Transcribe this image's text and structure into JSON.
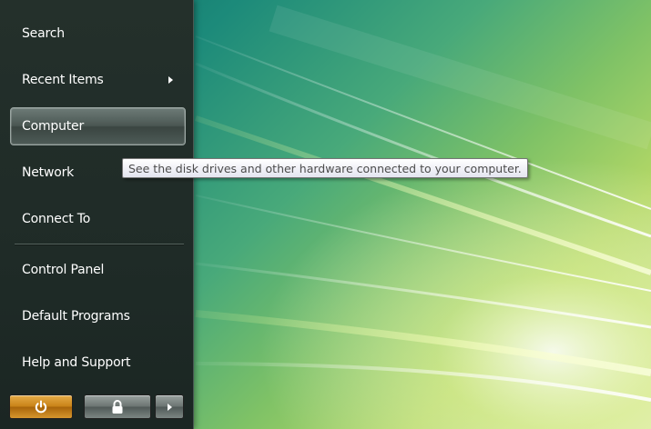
{
  "start_menu": {
    "items": [
      {
        "label": "Search",
        "has_submenu": false,
        "selected": false
      },
      {
        "label": "Recent Items",
        "has_submenu": true,
        "selected": false
      },
      {
        "label": "Computer",
        "has_submenu": false,
        "selected": true
      },
      {
        "label": "Network",
        "has_submenu": false,
        "selected": false
      },
      {
        "label": "Connect To",
        "has_submenu": false,
        "selected": false
      },
      {
        "label": "Control Panel",
        "has_submenu": false,
        "selected": false
      },
      {
        "label": "Default Programs",
        "has_submenu": false,
        "selected": false
      },
      {
        "label": "Help and Support",
        "has_submenu": false,
        "selected": false
      }
    ],
    "bottom_buttons": {
      "power_icon": "power-icon",
      "lock_icon": "lock-icon",
      "more_icon": "arrow-right-icon"
    }
  },
  "tooltip": {
    "text": "See the disk drives and other hardware connected to your computer."
  },
  "colors": {
    "power_button": "#c98318",
    "menu_background": "#1f2b27",
    "wallpaper_accent": "#48a97a"
  }
}
